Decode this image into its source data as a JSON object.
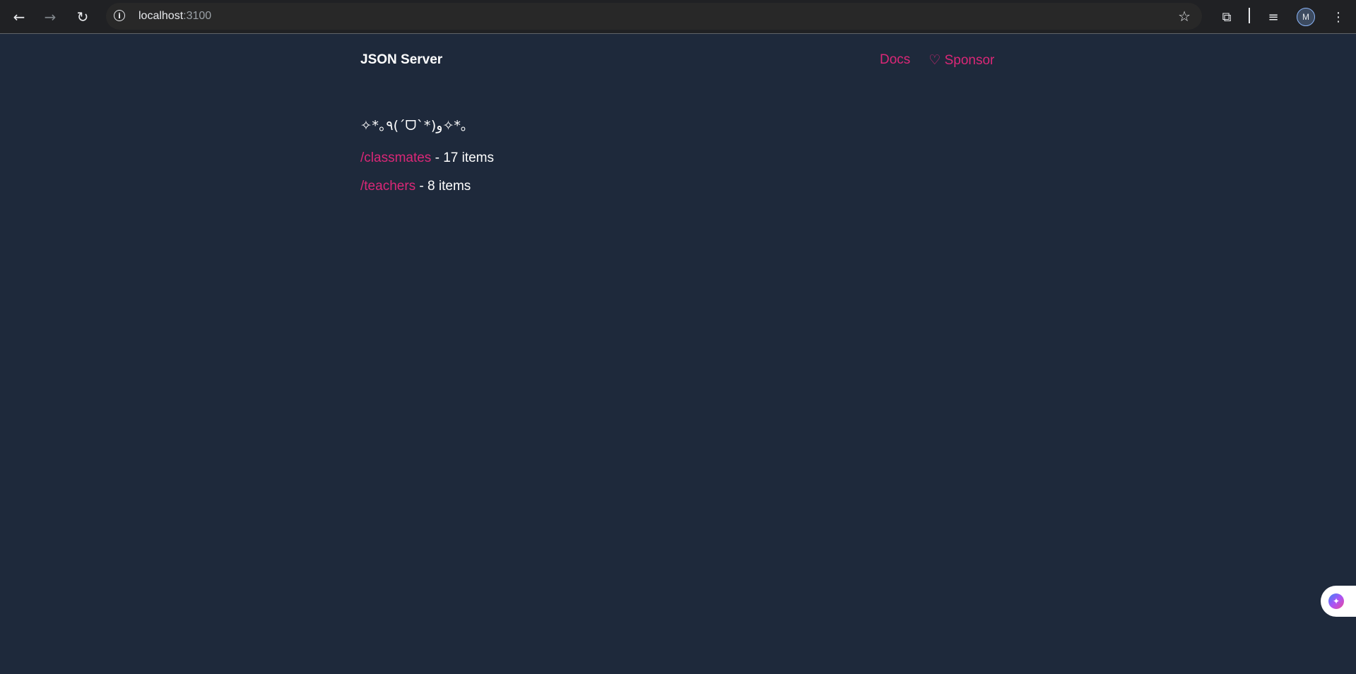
{
  "browser": {
    "url_host": "localhost",
    "url_port": ":3100",
    "back_icon": "←",
    "forward_icon": "→",
    "reload_icon": "↻",
    "info_icon": "i",
    "star_icon": "☆",
    "extensions_icon": "⧉",
    "media_icon": "≡",
    "avatar_initial": "M",
    "menu_icon": "⋮"
  },
  "header": {
    "brand": "JSON Server",
    "links": {
      "docs": "Docs",
      "sponsor": "♡ Sponsor"
    }
  },
  "main": {
    "kaomoji": "✧*｡٩(ˊᗜˋ*)و✧*｡",
    "resources": [
      {
        "path": "/classmates",
        "suffix": " - 17 items"
      },
      {
        "path": "/teachers",
        "suffix": " - 8 items"
      }
    ]
  },
  "colors": {
    "background": "#1e293b",
    "accent": "#db2777",
    "text": "#ffffff"
  }
}
